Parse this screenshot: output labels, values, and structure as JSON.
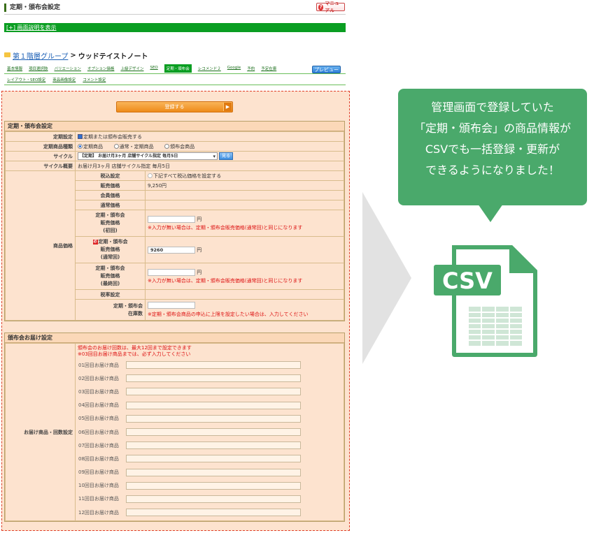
{
  "header": {
    "title": "定期・頒布会設定",
    "manual_label": "マニュアル",
    "help_toggle": "[+] 画面説明を表示"
  },
  "breadcrumb": {
    "group": "第１階層グループ",
    "separator": ">",
    "current": "ウッドテイストノート"
  },
  "tabs_row1": [
    "基本情報",
    "項目選択肢",
    "バリエーション",
    "オプション価格",
    "上級デザイン",
    "SEO",
    "定期・頒布会",
    "レコメンド２",
    "Google",
    "予約",
    "予定在庫"
  ],
  "tabs_row1_active": "定期・頒布会",
  "tabs_row2": [
    "レイアウト・SEO設定",
    "商品画像設定",
    "コメント設定"
  ],
  "preview_label": "プレビュー",
  "register_button": "登録する",
  "section1": {
    "title": "定期・頒布会設定",
    "rows": {
      "teiki_label": "定期設定",
      "teiki_value": "定期または頒布会販売する",
      "type_label": "定期商品種類",
      "type_options": [
        "定期商品",
        "通常・定期商品",
        "頒布会商品"
      ],
      "cycle_label": "サイクル",
      "cycle_value": "【定期】 お届け月3ヶ月 店舗サイクル指定 毎月5日",
      "cycle_btn": "見る",
      "cycle_summary_label": "サイクル概要",
      "cycle_summary_value": "お届け月3ヶ月 店舗サイクル指定 毎月5日",
      "price_label": "商品価格",
      "tax_label": "税込設定",
      "tax_value": "下記すべて税込価格を設定する",
      "sale_price_label": "販売価格",
      "sale_price_value": "9,250円",
      "member_price_label": "会員価格",
      "normal_price_label": "通常価格",
      "first_label": [
        "定期・頒布会",
        "販売価格",
        "(初回)"
      ],
      "yen": "円",
      "first_note": "※入力が無い場合は、定期・頒布会販売価格(通常回)と同じになります",
      "regular_label": [
        "定期・頒布会",
        "販売価格",
        "(通常回)"
      ],
      "regular_value": "9260",
      "required_mark": "必",
      "last_label": [
        "定期・頒布会",
        "販売価格",
        "(最終回)"
      ],
      "last_note": "※入力が無い場合は、定期・頒布会販売価格(通常回)と同じになります",
      "tax_rate_label": "税率設定",
      "stock_label": [
        "定期・頒布会",
        "在庫数"
      ],
      "stock_note": "※定期・頒布会商品の申込に上限を設定したい場合は、入力してください"
    }
  },
  "section2": {
    "title": "頒布会お届け設定",
    "row_label": "お届け商品・回数設定",
    "note1": "頒布会のお届け回数は、最大12回まで設定できます",
    "note2": "※03回目お届け商品までは、必ず入力してください",
    "items": [
      "01回目お届け商品",
      "02回目お届け商品",
      "03回目お届け商品",
      "04回目お届け商品",
      "05回目お届け商品",
      "06回目お届け商品",
      "07回目お届け商品",
      "08回目お届け商品",
      "09回目お届け商品",
      "10回目お届け商品",
      "11回目お届け商品",
      "12回目お届け商品"
    ]
  },
  "callout": {
    "lines": [
      "管理画面で登録していた",
      "「定期・頒布会」の商品情報が",
      "CSVでも一括登録・更新が",
      "できるようになりました！"
    ]
  },
  "csv_icon_label": "CSV",
  "colors": {
    "accent_green": "#4aa96b",
    "panel_bg": "#fde3cf",
    "dashed_border": "#e0402a",
    "tab_green": "#0a9e22"
  }
}
